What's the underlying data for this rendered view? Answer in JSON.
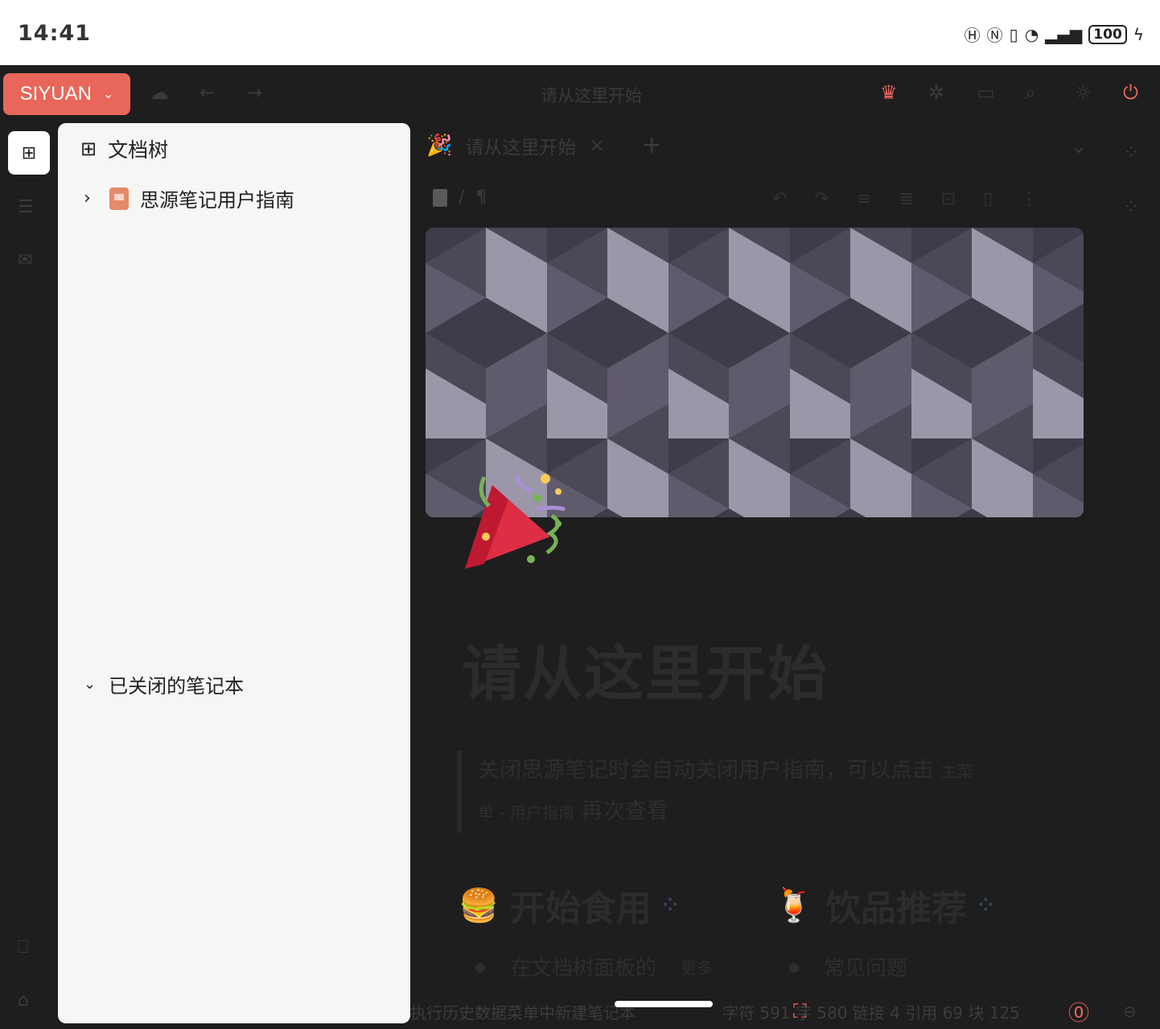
{
  "statusbar": {
    "time": "14:41",
    "battery": "100"
  },
  "toolbar": {
    "brand": "SIYUAN",
    "doc_title": "请从这里开始"
  },
  "panel": {
    "title": "文档树",
    "notebook": "思源笔记用户指南",
    "closed_label": "已关闭的笔记本"
  },
  "editor": {
    "tab_label": "请从这里开始",
    "tab_close": "×",
    "breadcrumb_sep": "/",
    "breadcrumb_mark": "¶",
    "title": "请从这里开始",
    "quote_line1_main": "关闭思源笔记时会自动关闭用户指南，可以点击",
    "quote_line1_small": "主菜",
    "quote_line2_small": "单 - 用户指南",
    "quote_line2_main": "再次查看",
    "heading1": "开始食用",
    "heading2": "饮品推荐",
    "list1_text": "在文档树面板的",
    "list1_small": "更多",
    "list2_text": "常见问题"
  },
  "footer": {
    "status_text": "执行历史数据菜单中新建笔记本",
    "stats": "字符 591  字 580  链接 4  引用 69  块 125"
  }
}
